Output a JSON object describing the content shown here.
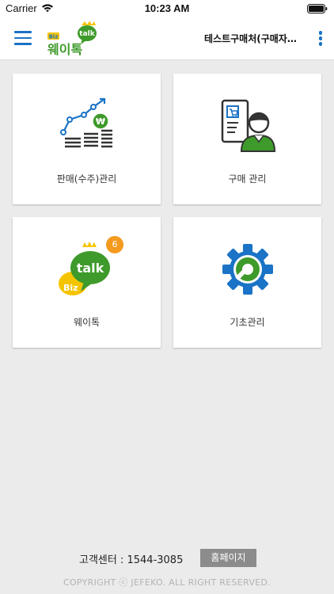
{
  "status_bar": {
    "carrier": "Carrier",
    "time": "10:23 AM",
    "icons": [
      "wifi-icon",
      "battery-icon"
    ]
  },
  "header": {
    "logo_text": "Biz talk 웨이톡",
    "title": "테스트구매처(구매자여…",
    "icons": [
      "menu-icon",
      "more-vertical-icon"
    ]
  },
  "tiles": [
    {
      "label": "판매(수주)관리",
      "icon": "sales-chart-icon"
    },
    {
      "label": "구매 관리",
      "icon": "purchase-person-icon"
    },
    {
      "label": "웨이톡",
      "icon": "biz-talk-icon",
      "badge": "6"
    },
    {
      "label": "기초관리",
      "icon": "settings-gear-icon"
    }
  ],
  "footer": {
    "support": "고객센터 : 1544-3085",
    "homepage_button": "홈페이지",
    "copyright": "COPYRIGHT ⓒ JEFEKO. ALL RIGHT RESERVED."
  },
  "colors": {
    "accent_blue": "#1a73c6",
    "green": "#3e9a2a",
    "yellow": "#f5c400",
    "badge_orange": "#f39a1f",
    "background": "#ebebeb"
  }
}
